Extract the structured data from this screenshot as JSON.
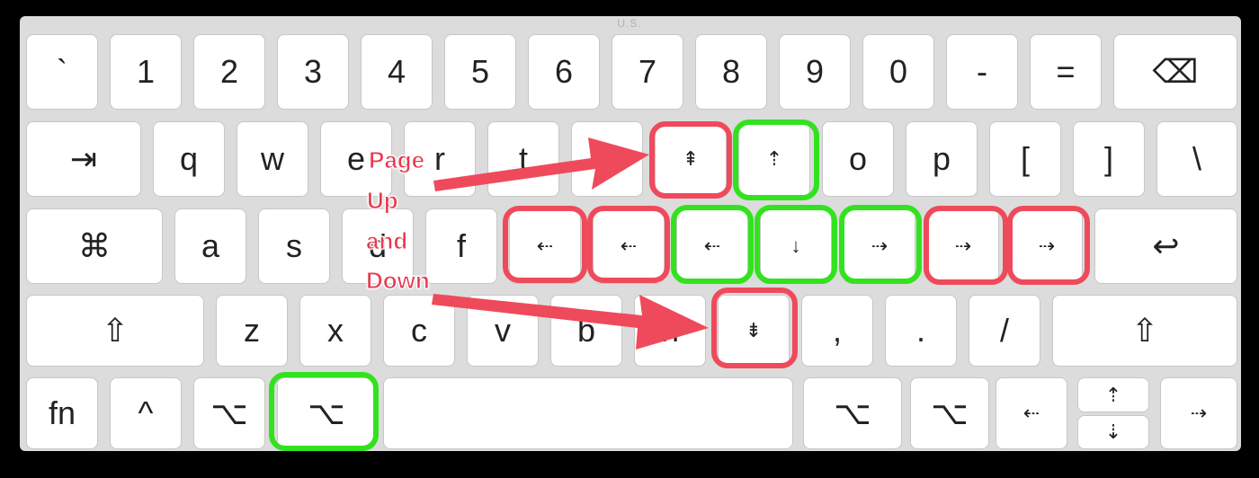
{
  "keyboard_title": "U.S.",
  "rows": {
    "numbers": [
      "`",
      "1",
      "2",
      "3",
      "4",
      "5",
      "6",
      "7",
      "8",
      "9",
      "0",
      "-",
      "=",
      "⌫"
    ],
    "top": [
      "⇥",
      "q",
      "w",
      "e",
      "r",
      "t",
      "y",
      "⇞",
      "⇡",
      "o",
      "p",
      "[",
      "]",
      "\\"
    ],
    "home": [
      "⌘",
      "a",
      "s",
      "d",
      "f",
      "⇠",
      "⇠",
      "⇠",
      "↓",
      "⇢",
      "⇢",
      "⇢",
      "↩"
    ],
    "bottom": [
      "⇧",
      "z",
      "x",
      "c",
      "v",
      "b",
      "n",
      "⇟",
      ",",
      ".",
      "/",
      "⇧"
    ],
    "modifiers": [
      "fn",
      "^",
      "⌥",
      "⌥",
      "",
      "⌥",
      "⌥",
      "⇠",
      "⇡",
      "⇣",
      "⇢"
    ]
  },
  "annotation": {
    "lines": [
      "Page",
      "Up",
      "and",
      "Down"
    ]
  },
  "colors": {
    "red_highlight": "#ef4a5c",
    "green_highlight": "#33e21f",
    "annotation": "#e8384f"
  }
}
